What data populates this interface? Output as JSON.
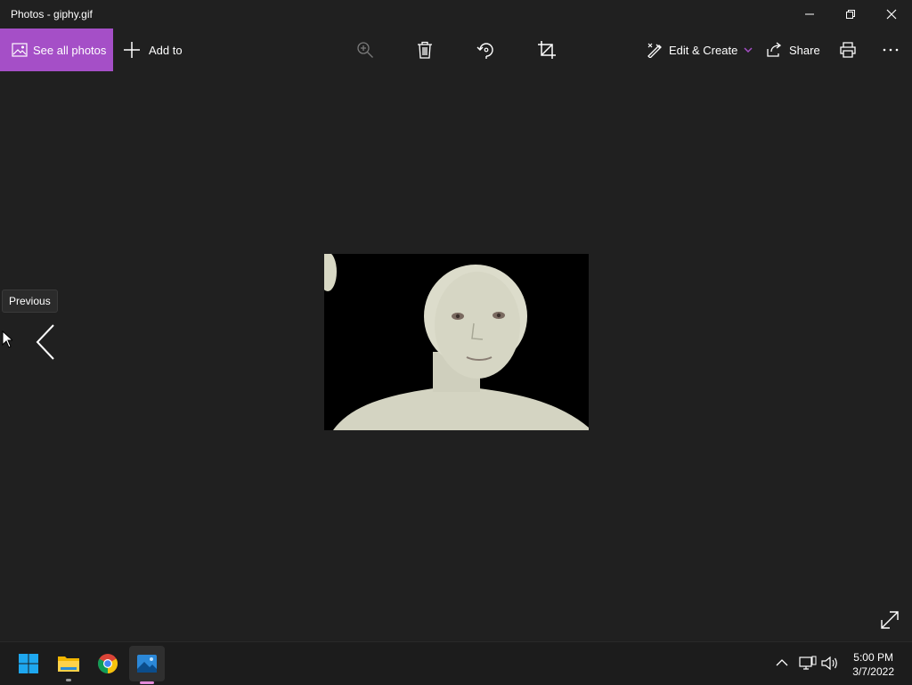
{
  "app": {
    "title": "Photos - giphy.gif"
  },
  "window_controls": {
    "minimize": "minimize-icon",
    "restore": "restore-icon",
    "close": "close-icon"
  },
  "toolbar": {
    "see_all_label": "See all photos",
    "add_to_label": "Add to",
    "edit_create_label": "Edit & Create",
    "share_label": "Share",
    "icons": [
      "zoom-icon",
      "delete-icon",
      "rotate-icon",
      "crop-icon",
      "print-icon",
      "more-icon"
    ]
  },
  "viewer": {
    "previous_tooltip": "Previous"
  },
  "taskbar": {
    "apps": [
      "windows-start-icon",
      "file-explorer-icon",
      "chrome-icon",
      "photos-icon"
    ],
    "time": "5:00 PM",
    "date": "3/7/2022"
  },
  "colors": {
    "accent": "#a54fc7",
    "background": "#202020",
    "taskbar": "#1c1c1c"
  }
}
